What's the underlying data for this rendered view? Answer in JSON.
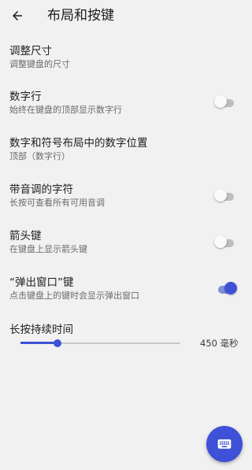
{
  "header": {
    "title": "布局和按键",
    "back_icon": "arrow-back-icon"
  },
  "settings": {
    "resize": {
      "title": "调整尺寸",
      "subtitle": "调整键盘的尺寸"
    },
    "number_row": {
      "title": "数字行",
      "subtitle": "始终在键盘的顶部显示数字行",
      "enabled": false
    },
    "symbol_layout": {
      "title": "数字和符号布局中的数字位置",
      "subtitle": "顶部（数字行）"
    },
    "accented_chars": {
      "title": "带音调的字符",
      "subtitle": "长按可查看所有可用音调",
      "enabled": false
    },
    "arrow_keys": {
      "title": "箭头键",
      "subtitle": "在键盘上显示箭头键",
      "enabled": false
    },
    "popup_keys": {
      "title": "“弹出窗口”键",
      "subtitle": "点击键盘上的键时会显示弹出窗口",
      "enabled": true
    },
    "long_press": {
      "title": "长按持续时间",
      "value_label": "450 毫秒",
      "level": 0.23
    }
  },
  "fab": {
    "icon": "keyboard-icon"
  },
  "colors": {
    "accent": "#3f51d6",
    "background": "#f1f1f1"
  }
}
